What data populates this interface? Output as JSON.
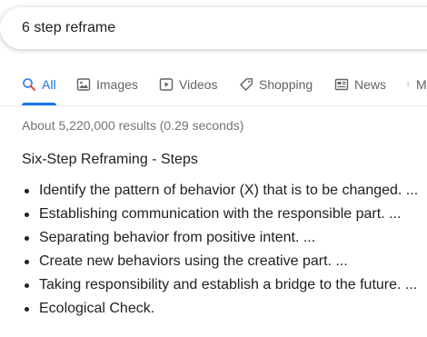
{
  "search": {
    "query": "6 step reframe"
  },
  "tabs": [
    {
      "label": "All",
      "icon": "search-icon",
      "active": true
    },
    {
      "label": "Images",
      "icon": "image-icon",
      "active": false
    },
    {
      "label": "Videos",
      "icon": "play-icon",
      "active": false
    },
    {
      "label": "Shopping",
      "icon": "tag-icon",
      "active": false
    },
    {
      "label": "News",
      "icon": "newspaper-icon",
      "active": false
    },
    {
      "label": "M",
      "icon": "more-vert-icon",
      "active": false
    }
  ],
  "results_stats": "About 5,220,000 results (0.29 seconds)",
  "featured_snippet": {
    "title": "Six-Step Reframing - Steps",
    "steps": [
      "Identify the pattern of behavior (X) that is to be changed. ...",
      "Establishing communication with the responsible part. ...",
      "Separating behavior from positive intent. ...",
      "Create new behaviors using the creative part. ...",
      "Taking responsibility and establish a bridge to the future. ...",
      "Ecological Check."
    ]
  },
  "colors": {
    "accent": "#1a73e8",
    "text": "#202124",
    "muted": "#70757a",
    "tab_text": "#5f6368"
  }
}
